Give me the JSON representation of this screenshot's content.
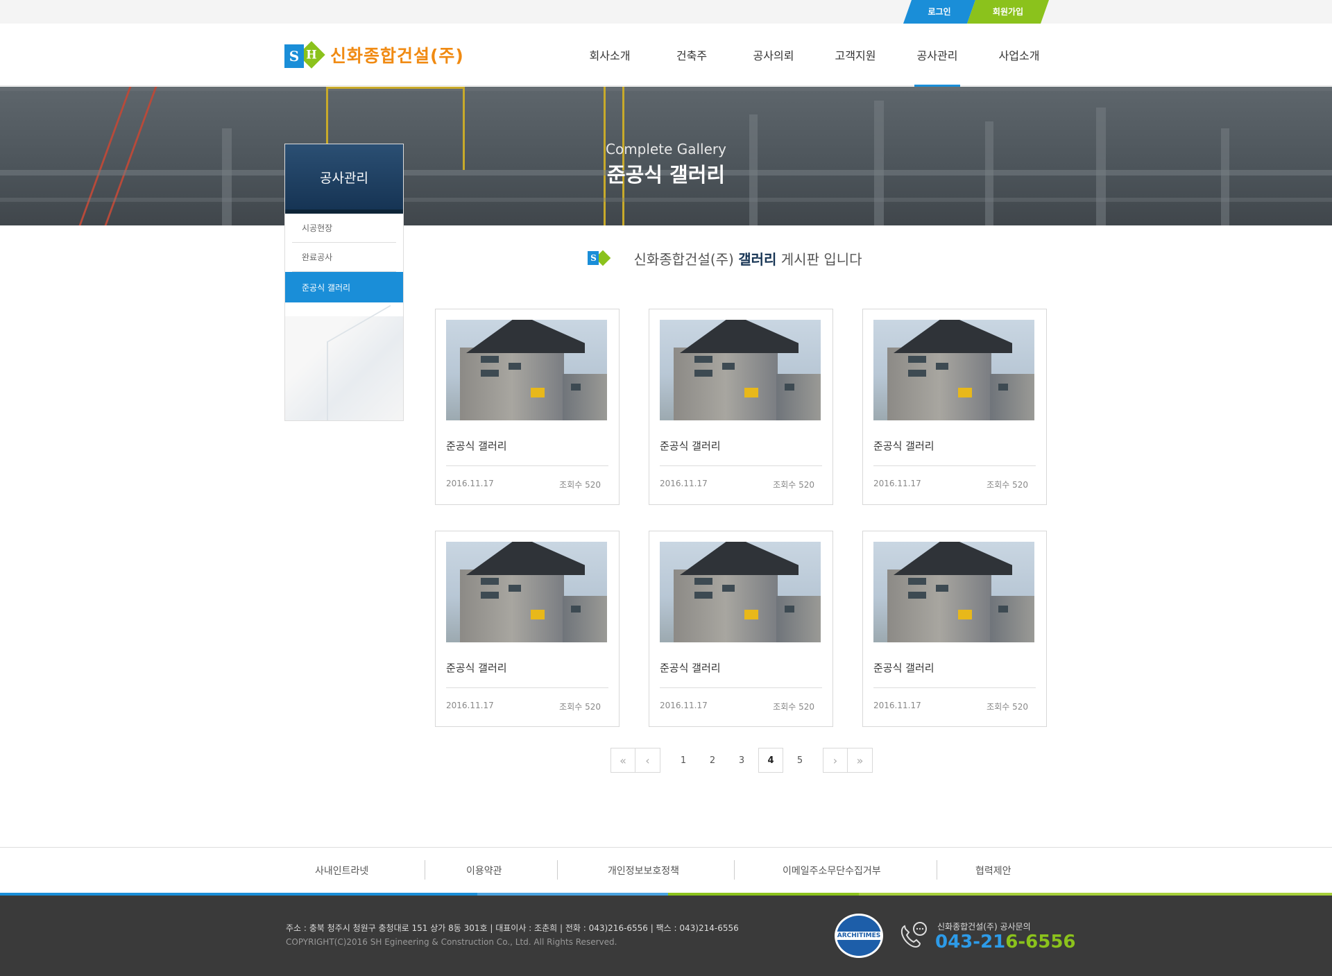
{
  "topbar": {
    "login": "로그인",
    "join": "회원가입"
  },
  "header": {
    "logo_mark_s": "S",
    "logo_mark_h": "H",
    "logo_text": "신화종합건설(주)",
    "nav": [
      "회사소개",
      "건축주",
      "공사의뢰",
      "고객지원",
      "공사관리",
      "사업소개"
    ],
    "active_nav": "공사관리"
  },
  "hero": {
    "title_en": "Complete Gallery",
    "title": "준공식 갤러리"
  },
  "sidebar": {
    "title": "공사관리",
    "items": [
      {
        "label": "시공현장",
        "active": false
      },
      {
        "label": "완료공사",
        "active": false
      },
      {
        "label": "준공식 갤러리",
        "active": true
      }
    ]
  },
  "intro": {
    "prefix": "신화종합건설(주)",
    "bold": "갤러리",
    "suffix": "게시판 입니다"
  },
  "gallery": [
    {
      "title": "준공식 갤러리",
      "date": "2016.11.17",
      "views": "조회수 520"
    },
    {
      "title": "준공식 갤러리",
      "date": "2016.11.17",
      "views": "조회수 520"
    },
    {
      "title": "준공식 갤러리",
      "date": "2016.11.17",
      "views": "조회수 520"
    },
    {
      "title": "준공식 갤러리",
      "date": "2016.11.17",
      "views": "조회수 520"
    },
    {
      "title": "준공식 갤러리",
      "date": "2016.11.17",
      "views": "조회수 520"
    },
    {
      "title": "준공식 갤러리",
      "date": "2016.11.17",
      "views": "조회수 520"
    }
  ],
  "pagination": {
    "first": "«",
    "prev": "‹",
    "next": "›",
    "last": "»",
    "pages": [
      "1",
      "2",
      "3",
      "4",
      "5"
    ],
    "current": "4"
  },
  "footer_links": [
    "사내인트라넷",
    "이용약관",
    "개인정보보호정책",
    "이메일주소무단수집거부",
    "협력제안"
  ],
  "footer": {
    "address": "주소 : 충북 청주시 청원구 충청대로 151 상가 8동 301호  |  대표이사 : 조춘희  |  전화 : 043)216-6556  |  팩스 : 043)214-6556",
    "copyright": "COPYRIGHT(C)2016  SH Egineering & Construction  Co., Ltd. All Rights Reserved.",
    "seal_text": "ARCHITIMES",
    "inquiry_label": "신화종합건설(주) 공사문의",
    "inquiry_number_a": "043-21",
    "inquiry_number_b": "6-6556"
  },
  "colors": {
    "blue": "#1a8ed8",
    "green": "#8bc21c",
    "orange": "#f08a12",
    "navy": "#163454",
    "footer_bg": "#3a3a3a"
  }
}
